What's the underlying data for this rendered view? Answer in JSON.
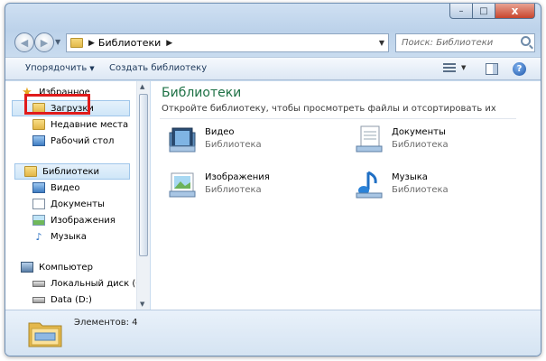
{
  "window": {
    "caption_buttons": {
      "minimize": "–",
      "maximize": "□",
      "close": "x"
    }
  },
  "address_bar": {
    "separator": "▶",
    "crumb": "Библиотеки",
    "crumb_arrow": "▶",
    "dropdown": "▼",
    "refresh": "↻"
  },
  "search": {
    "placeholder": "Поиск: Библиотеки"
  },
  "toolbar": {
    "organize": "Упорядочить",
    "organize_arrow": "▼",
    "create_library": "Создать библиотеку",
    "views_arrow": "▼",
    "help": "?"
  },
  "nav_pane": {
    "favorites": "Избранное",
    "downloads": "Загрузки",
    "recent": "Недавние места",
    "desktop": "Рабочий стол",
    "libraries": "Библиотеки",
    "videos": "Видео",
    "documents": "Документы",
    "pictures": "Изображения",
    "music": "Музыка",
    "computer": "Компьютер",
    "local_disk": "Локальный диск (C:)",
    "data_disk": "Data (D:)"
  },
  "content": {
    "title": "Библиотеки",
    "subtitle": "Откройте библиотеку, чтобы просмотреть файлы и отсортировать их по папке, дат",
    "tiles": [
      {
        "name": "Видео",
        "type": "Библиотека"
      },
      {
        "name": "Документы",
        "type": "Библиотека"
      },
      {
        "name": "Изображения",
        "type": "Библиотека"
      },
      {
        "name": "Музыка",
        "type": "Библиотека"
      }
    ]
  },
  "status_bar": {
    "items": "Элементов: 4"
  },
  "colors": {
    "title_green": "#1e7145",
    "highlight_red": "#e01b1b",
    "selection_blue": "#cfe6f8"
  }
}
